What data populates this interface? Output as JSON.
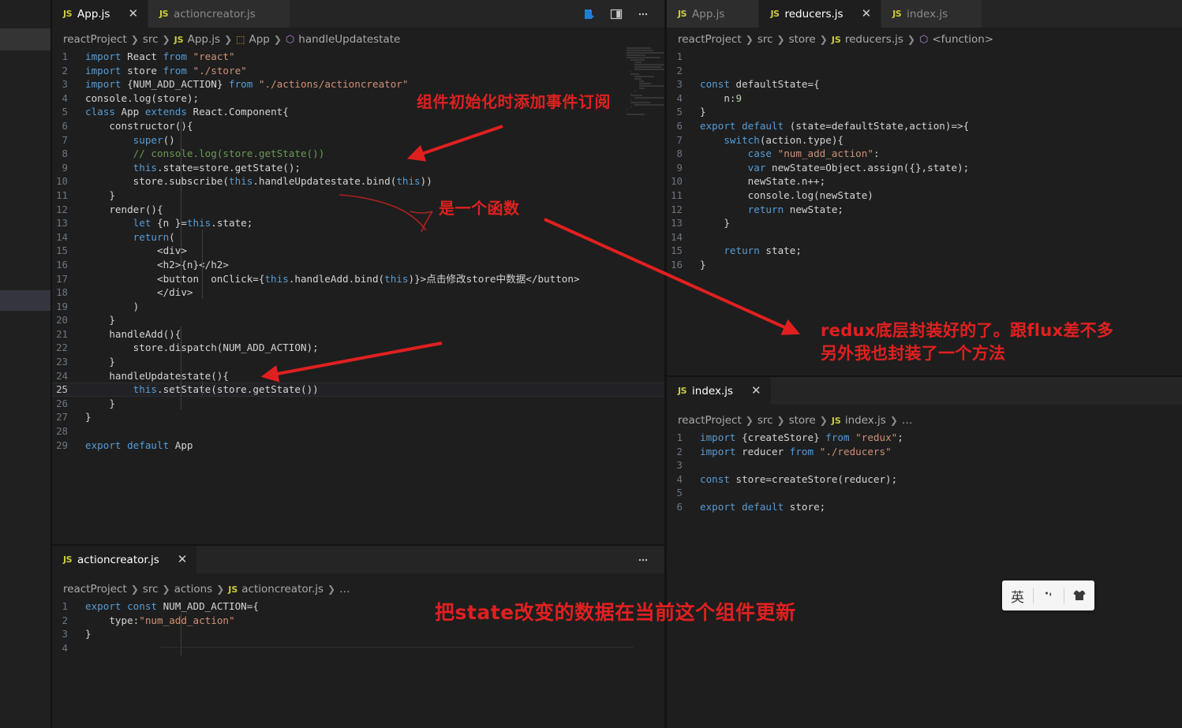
{
  "app": {
    "theme_bg": "#1e1e1e",
    "accent": "#cbcb41",
    "annotation_color": "#e02020"
  },
  "main_editor": {
    "tabs": [
      {
        "icon": "js-file-icon",
        "label": "App.js",
        "active": true,
        "closable": true
      },
      {
        "icon": "js-file-icon",
        "label": "actioncreator.js",
        "active": false,
        "closable": false
      }
    ],
    "actions": [
      {
        "name": "open-preview-icon",
        "label": ""
      },
      {
        "name": "split-editor-icon",
        "label": ""
      },
      {
        "name": "more-actions-icon",
        "label": "…"
      }
    ],
    "breadcrumb": [
      "reactProject",
      "src",
      "App.js",
      "App",
      "handleUpdatestate"
    ],
    "breadcrumb_icons": {
      "2": "js-file-icon",
      "3": "class-icon",
      "4": "method-icon"
    },
    "lines": [
      {
        "n": 1,
        "tokens": [
          [
            "kw",
            "import"
          ],
          [
            "plain",
            " React "
          ],
          [
            "kw",
            "from"
          ],
          [
            "plain",
            " "
          ],
          [
            "str",
            "\"react\""
          ]
        ]
      },
      {
        "n": 2,
        "tokens": [
          [
            "kw",
            "import"
          ],
          [
            "plain",
            " store "
          ],
          [
            "kw",
            "from"
          ],
          [
            "plain",
            " "
          ],
          [
            "str",
            "\"./store\""
          ]
        ]
      },
      {
        "n": 3,
        "tokens": [
          [
            "kw",
            "import"
          ],
          [
            "plain",
            " {NUM_ADD_ACTION} "
          ],
          [
            "kw",
            "from"
          ],
          [
            "plain",
            " "
          ],
          [
            "str",
            "\"./actions/actioncreator\""
          ]
        ]
      },
      {
        "n": 4,
        "tokens": [
          [
            "plain",
            "console.log(store);"
          ]
        ]
      },
      {
        "n": 5,
        "tokens": [
          [
            "kw",
            "class"
          ],
          [
            "plain",
            " App "
          ],
          [
            "kw",
            "extends"
          ],
          [
            "plain",
            " React.Component{"
          ]
        ]
      },
      {
        "n": 6,
        "tokens": [
          [
            "plain",
            "    constructor(){"
          ]
        ]
      },
      {
        "n": 7,
        "tokens": [
          [
            "plain",
            "        "
          ],
          [
            "kw",
            "super"
          ],
          [
            "plain",
            "()"
          ]
        ]
      },
      {
        "n": 8,
        "tokens": [
          [
            "plain",
            "        "
          ],
          [
            "cmt",
            "// console.log(store.getState())"
          ]
        ]
      },
      {
        "n": 9,
        "tokens": [
          [
            "plain",
            "        "
          ],
          [
            "this",
            "this"
          ],
          [
            "plain",
            ".state=store.getState();"
          ]
        ]
      },
      {
        "n": 10,
        "tokens": [
          [
            "plain",
            "        store.subscribe("
          ],
          [
            "this",
            "this"
          ],
          [
            "plain",
            ".handleUpdatestate.bind("
          ],
          [
            "this",
            "this"
          ],
          [
            "plain",
            "))"
          ]
        ]
      },
      {
        "n": 11,
        "tokens": [
          [
            "plain",
            "    }"
          ]
        ]
      },
      {
        "n": 12,
        "tokens": [
          [
            "plain",
            "    render(){"
          ]
        ]
      },
      {
        "n": 13,
        "tokens": [
          [
            "plain",
            "        "
          ],
          [
            "kw",
            "let"
          ],
          [
            "plain",
            " {n }="
          ],
          [
            "this",
            "this"
          ],
          [
            "plain",
            ".state;"
          ]
        ]
      },
      {
        "n": 14,
        "tokens": [
          [
            "plain",
            "        "
          ],
          [
            "kw",
            "return"
          ],
          [
            "plain",
            "("
          ]
        ]
      },
      {
        "n": 15,
        "tokens": [
          [
            "plain",
            "            <div>"
          ]
        ]
      },
      {
        "n": 16,
        "tokens": [
          [
            "plain",
            "            <h2>{n}</h2>"
          ]
        ]
      },
      {
        "n": 17,
        "tokens": [
          [
            "plain",
            "            <button  onClick={"
          ],
          [
            "this",
            "this"
          ],
          [
            "plain",
            ".handleAdd.bind("
          ],
          [
            "this",
            "this"
          ],
          [
            "plain",
            ")}>点击修改store中数据</button>"
          ]
        ]
      },
      {
        "n": 18,
        "tokens": [
          [
            "plain",
            "            </div>"
          ]
        ]
      },
      {
        "n": 19,
        "tokens": [
          [
            "plain",
            "        )"
          ]
        ]
      },
      {
        "n": 20,
        "tokens": [
          [
            "plain",
            "    }"
          ]
        ]
      },
      {
        "n": 21,
        "tokens": [
          [
            "plain",
            "    handleAdd(){"
          ]
        ]
      },
      {
        "n": 22,
        "tokens": [
          [
            "plain",
            "        store.dispatch(NUM_ADD_ACTION);"
          ]
        ]
      },
      {
        "n": 23,
        "tokens": [
          [
            "plain",
            "    }"
          ]
        ]
      },
      {
        "n": 24,
        "tokens": [
          [
            "plain",
            "    handleUpdatestate(){"
          ]
        ]
      },
      {
        "n": 25,
        "tokens": [
          [
            "plain",
            "        "
          ],
          [
            "this",
            "this"
          ],
          [
            "plain",
            ".setState(store.getState())"
          ]
        ],
        "current": true
      },
      {
        "n": 26,
        "tokens": [
          [
            "plain",
            "    }"
          ]
        ]
      },
      {
        "n": 27,
        "tokens": [
          [
            "plain",
            "}"
          ]
        ]
      },
      {
        "n": 28,
        "tokens": [
          [
            "plain",
            ""
          ]
        ]
      },
      {
        "n": 29,
        "tokens": [
          [
            "kw",
            "export"
          ],
          [
            "plain",
            " "
          ],
          [
            "kw",
            "default"
          ],
          [
            "plain",
            " App"
          ]
        ]
      }
    ]
  },
  "bottom_editor": {
    "tabs": [
      {
        "icon": "js-file-icon",
        "label": "actioncreator.js",
        "active": true,
        "closable": true
      }
    ],
    "actions": [
      {
        "name": "more-actions-icon",
        "label": "…"
      }
    ],
    "breadcrumb": [
      "reactProject",
      "src",
      "actions",
      "actioncreator.js",
      "…"
    ],
    "lines": [
      {
        "n": 1,
        "tokens": [
          [
            "kw",
            "export"
          ],
          [
            "plain",
            " "
          ],
          [
            "kw",
            "const"
          ],
          [
            "plain",
            " NUM_ADD_ACTION={"
          ]
        ]
      },
      {
        "n": 2,
        "tokens": [
          [
            "plain",
            "    type:"
          ],
          [
            "str",
            "\"num_add_action\""
          ]
        ]
      },
      {
        "n": 3,
        "tokens": [
          [
            "plain",
            "}"
          ]
        ]
      },
      {
        "n": 4,
        "tokens": [
          [
            "plain",
            ""
          ]
        ]
      }
    ]
  },
  "right_top_editor": {
    "tabs": [
      {
        "icon": "js-file-icon",
        "label": "App.js",
        "active": false,
        "closable": false
      },
      {
        "icon": "js-file-icon",
        "label": "reducers.js",
        "active": true,
        "closable": true
      },
      {
        "icon": "js-file-icon",
        "label": "index.js",
        "active": false,
        "closable": false
      }
    ],
    "breadcrumb": [
      "reactProject",
      "src",
      "store",
      "reducers.js",
      "<function>"
    ],
    "lines": [
      {
        "n": 1,
        "tokens": [
          [
            "plain",
            ""
          ]
        ]
      },
      {
        "n": 2,
        "tokens": [
          [
            "plain",
            ""
          ]
        ]
      },
      {
        "n": 3,
        "tokens": [
          [
            "kw",
            "const"
          ],
          [
            "plain",
            " defaultState={"
          ]
        ]
      },
      {
        "n": 4,
        "tokens": [
          [
            "plain",
            "    n:"
          ],
          [
            "num",
            "9"
          ]
        ]
      },
      {
        "n": 5,
        "tokens": [
          [
            "plain",
            "}"
          ]
        ]
      },
      {
        "n": 6,
        "tokens": [
          [
            "kw",
            "export"
          ],
          [
            "plain",
            " "
          ],
          [
            "kw",
            "default"
          ],
          [
            "plain",
            " (state=defaultState,action)=>{"
          ]
        ]
      },
      {
        "n": 7,
        "tokens": [
          [
            "plain",
            "    "
          ],
          [
            "kw",
            "switch"
          ],
          [
            "plain",
            "(action.type){"
          ]
        ]
      },
      {
        "n": 8,
        "tokens": [
          [
            "plain",
            "        "
          ],
          [
            "kw",
            "case"
          ],
          [
            "plain",
            " "
          ],
          [
            "str",
            "\"num_add_action\""
          ],
          [
            "plain",
            ":"
          ]
        ]
      },
      {
        "n": 9,
        "tokens": [
          [
            "plain",
            "        "
          ],
          [
            "kw",
            "var"
          ],
          [
            "plain",
            " newState=Object.assign({},state);"
          ]
        ]
      },
      {
        "n": 10,
        "tokens": [
          [
            "plain",
            "        newState.n++;"
          ]
        ]
      },
      {
        "n": 11,
        "tokens": [
          [
            "plain",
            "        console.log(newState)"
          ]
        ]
      },
      {
        "n": 12,
        "tokens": [
          [
            "plain",
            "        "
          ],
          [
            "kw",
            "return"
          ],
          [
            "plain",
            " newState;"
          ]
        ]
      },
      {
        "n": 13,
        "tokens": [
          [
            "plain",
            "    }"
          ]
        ]
      },
      {
        "n": 14,
        "tokens": [
          [
            "plain",
            ""
          ]
        ]
      },
      {
        "n": 15,
        "tokens": [
          [
            "plain",
            "    "
          ],
          [
            "kw",
            "return"
          ],
          [
            "plain",
            " state;"
          ]
        ]
      },
      {
        "n": 16,
        "tokens": [
          [
            "plain",
            "}"
          ]
        ]
      }
    ]
  },
  "right_bottom_editor": {
    "tabs": [
      {
        "icon": "js-file-icon",
        "label": "index.js",
        "active": true,
        "closable": true
      }
    ],
    "breadcrumb": [
      "reactProject",
      "src",
      "store",
      "index.js",
      "…"
    ],
    "lines": [
      {
        "n": 1,
        "tokens": [
          [
            "kw",
            "import"
          ],
          [
            "plain",
            " {createStore} "
          ],
          [
            "kw",
            "from"
          ],
          [
            "plain",
            " "
          ],
          [
            "str",
            "\"redux\""
          ],
          [
            "plain",
            ";"
          ]
        ]
      },
      {
        "n": 2,
        "tokens": [
          [
            "kw",
            "import"
          ],
          [
            "plain",
            " reducer "
          ],
          [
            "kw",
            "from"
          ],
          [
            "plain",
            " "
          ],
          [
            "str",
            "\"./reducers\""
          ]
        ]
      },
      {
        "n": 3,
        "tokens": [
          [
            "plain",
            ""
          ]
        ]
      },
      {
        "n": 4,
        "tokens": [
          [
            "kw",
            "const"
          ],
          [
            "plain",
            " store=createStore(reducer);"
          ]
        ]
      },
      {
        "n": 5,
        "tokens": [
          [
            "plain",
            ""
          ]
        ]
      },
      {
        "n": 6,
        "tokens": [
          [
            "kw",
            "export"
          ],
          [
            "plain",
            " "
          ],
          [
            "kw",
            "default"
          ],
          [
            "plain",
            " store;"
          ]
        ]
      }
    ]
  },
  "annotations": [
    {
      "id": "anno-subscribe",
      "text": "组件初始化时添加事件订阅"
    },
    {
      "id": "anno-function",
      "text": "是一个函数"
    },
    {
      "id": "anno-redux",
      "text": "redux底层封装好的了。跟flux差不多\n另外我也封装了一个方法"
    },
    {
      "id": "anno-setstate",
      "text": "把state改变的数据在当前这个组件更新"
    }
  ],
  "ime_widget": {
    "mode_label": "英",
    "punctuation_icon": "comma-icon",
    "skin_icon": "shirt-icon"
  }
}
